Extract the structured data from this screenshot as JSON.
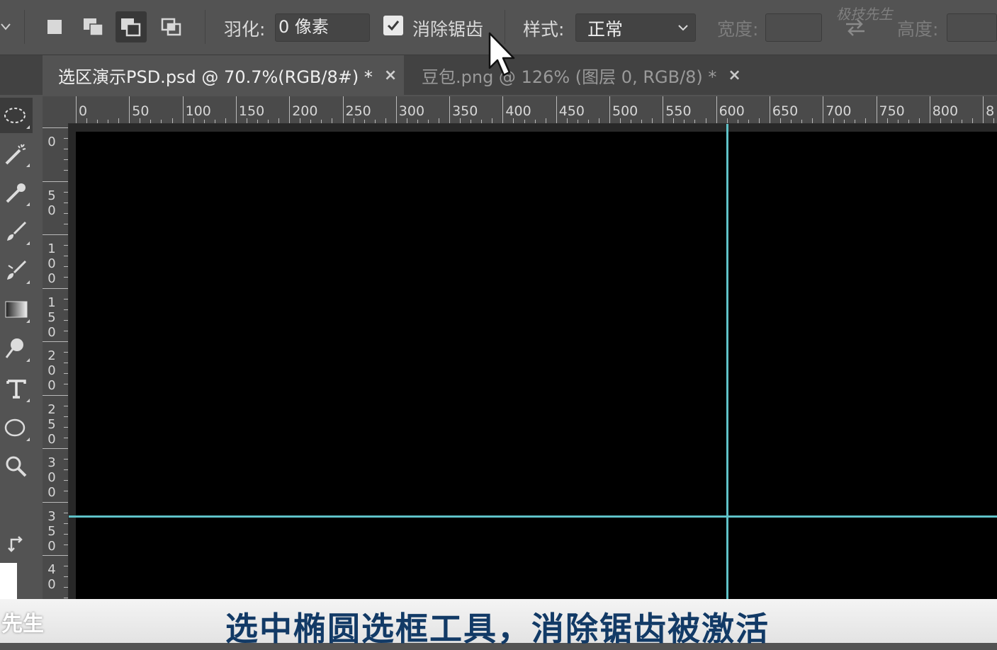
{
  "options_bar": {
    "feather_label": "羽化:",
    "feather_value": "0 像素",
    "antialias_label": "消除锯齿",
    "style_label": "样式:",
    "style_value": "正常",
    "width_label": "宽度:",
    "height_label": "高度:",
    "watermark": "极技先生"
  },
  "tabs": [
    {
      "label": "选区演示PSD.psd @ 70.7%(RGB/8#) *",
      "close": "×",
      "active": true
    },
    {
      "label": "豆包.png @ 126% (图层 0, RGB/8) *",
      "close": "×",
      "active": false
    }
  ],
  "ruler_h": [
    "0",
    "50",
    "100",
    "150",
    "200",
    "250",
    "300",
    "350",
    "400",
    "450",
    "500",
    "550",
    "600",
    "650",
    "700",
    "750",
    "800",
    "8"
  ],
  "ruler_v": [
    "0",
    "50",
    "100",
    "150",
    "200",
    "250",
    "300",
    "350",
    "40"
  ],
  "tools": [
    "ellipse-marquee-icon",
    "magic-wand-icon",
    "eyedropper-icon",
    "brush-icon",
    "clone-stamp-icon",
    "gradient-icon",
    "dodge-icon",
    "type-icon",
    "ellipse-shape-icon",
    "zoom-icon",
    "swap-colors-icon"
  ],
  "colors": {
    "guide": "#5fc2c8",
    "caption_text": "#123a66",
    "panel": "#535353"
  },
  "caption": {
    "logo": "先生",
    "text": "选中椭圆选框工具，消除锯齿被激活"
  }
}
